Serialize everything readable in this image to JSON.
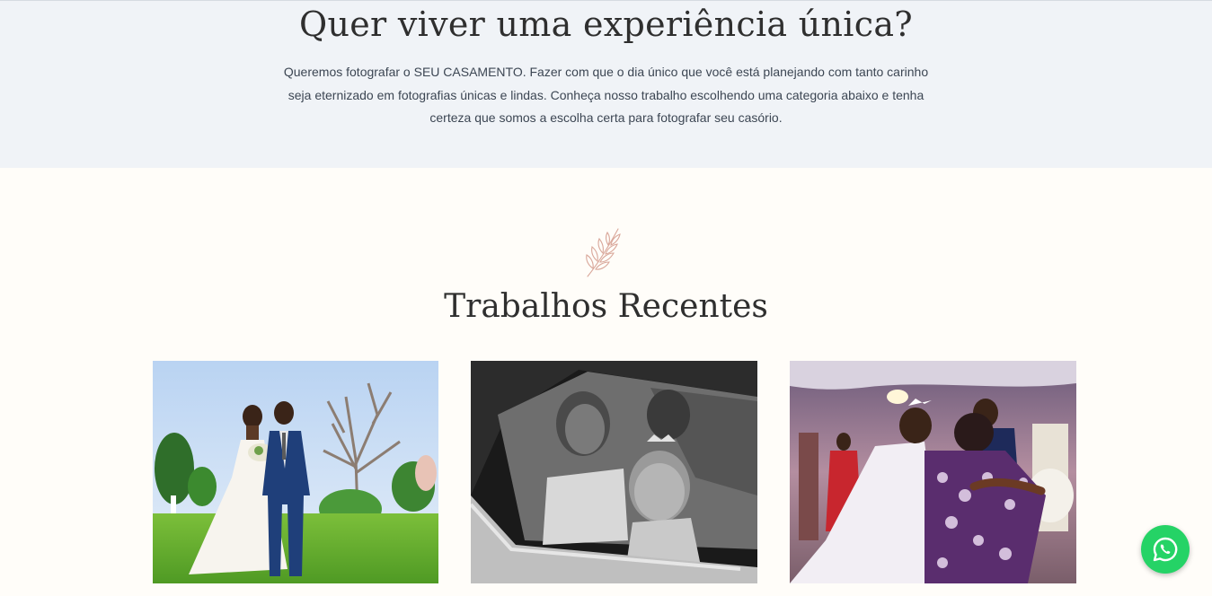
{
  "hero": {
    "title": "Quer viver uma experiência única?",
    "description": "Queremos fotografar o SEU CASAMENTO. Fazer com que o dia único que você está planejando com tanto carinho seja eternizado em fotografias únicas e lindas. Conheça nosso trabalho escolhendo uma categoria abaixo e tenha certeza que somos a escolha certa para fotografar seu casório."
  },
  "recent": {
    "title": "Trabalhos Recentes",
    "icon": "leaf-branch-icon"
  },
  "gallery": [
    {
      "name": "wedding-couple-garden-photo"
    },
    {
      "name": "bride-child-car-bw-photo"
    },
    {
      "name": "reception-hug-photo"
    }
  ],
  "whatsapp": {
    "icon": "whatsapp-icon",
    "color": "#25d366"
  },
  "colors": {
    "hero_bg": "#f0f3f7",
    "page_bg": "#fffdf9",
    "leaf": "#d9a79a"
  }
}
